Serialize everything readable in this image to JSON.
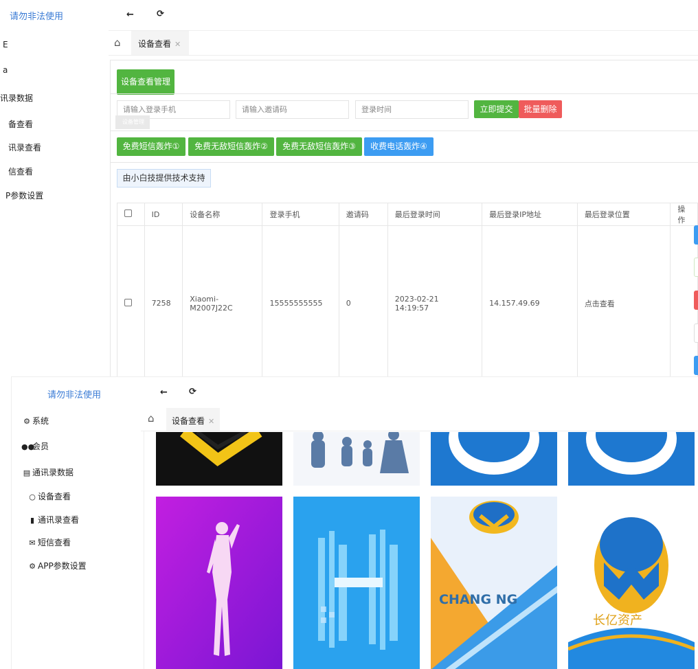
{
  "top": {
    "brand": "请勿非法使用",
    "sidebar_items": [
      "E",
      "a",
      "讯录数据",
      "备查看",
      "讯录查看",
      "信查看",
      "P参数设置"
    ],
    "tab_label": "设备查看",
    "panel_title": "设备查看管理",
    "filters": {
      "phone_placeholder": "请输入登录手机",
      "invite_placeholder": "请输入邀请码",
      "time_placeholder": "登录时间"
    },
    "submit_label": "立即提交",
    "batch_delete_label": "批量删除",
    "tooltip_ghost": "设备管理",
    "bomb_buttons": [
      "免费短信轰炸①",
      "免费无敌短信轰炸②",
      "免费无敌短信轰炸③",
      "收费电话轰炸④"
    ],
    "support_label": "由小白技提供技术支持",
    "table": {
      "headers": [
        "ID",
        "设备名称",
        "登录手机",
        "邀请码",
        "最后登录时间",
        "最后登录IP地址",
        "最后登录位置",
        "操作"
      ],
      "row": {
        "id": "7258",
        "device": "Xiaomi-M2007J22C",
        "phone": "15555555555",
        "invite": "0",
        "last_time": "2023-02-21 14:19:57",
        "last_ip": "14.157.49.69",
        "location": "点击查看"
      }
    }
  },
  "bottom": {
    "brand": "请勿非法使用",
    "tab_label": "设备查看",
    "sidebar_items": [
      {
        "icon": "gear-icon",
        "label": "系统"
      },
      {
        "icon": "users-icon",
        "label": "会员"
      },
      {
        "icon": "id-card-icon",
        "label": "通讯录数据"
      },
      {
        "icon": "user-outline-icon",
        "label": "设备查看"
      },
      {
        "icon": "book-icon",
        "label": "通讯录查看"
      },
      {
        "icon": "envelope-icon",
        "label": "短信查看"
      },
      {
        "icon": "gear-icon",
        "label": "APP参数设置"
      }
    ],
    "thumbnail_text": "CHANG NG",
    "thumbnail_caption": "长亿资产"
  },
  "colors": {
    "brand_blue": "#3a7bd5",
    "green": "#52b540",
    "red": "#ef5b5b",
    "blue": "#3c9cf2"
  }
}
